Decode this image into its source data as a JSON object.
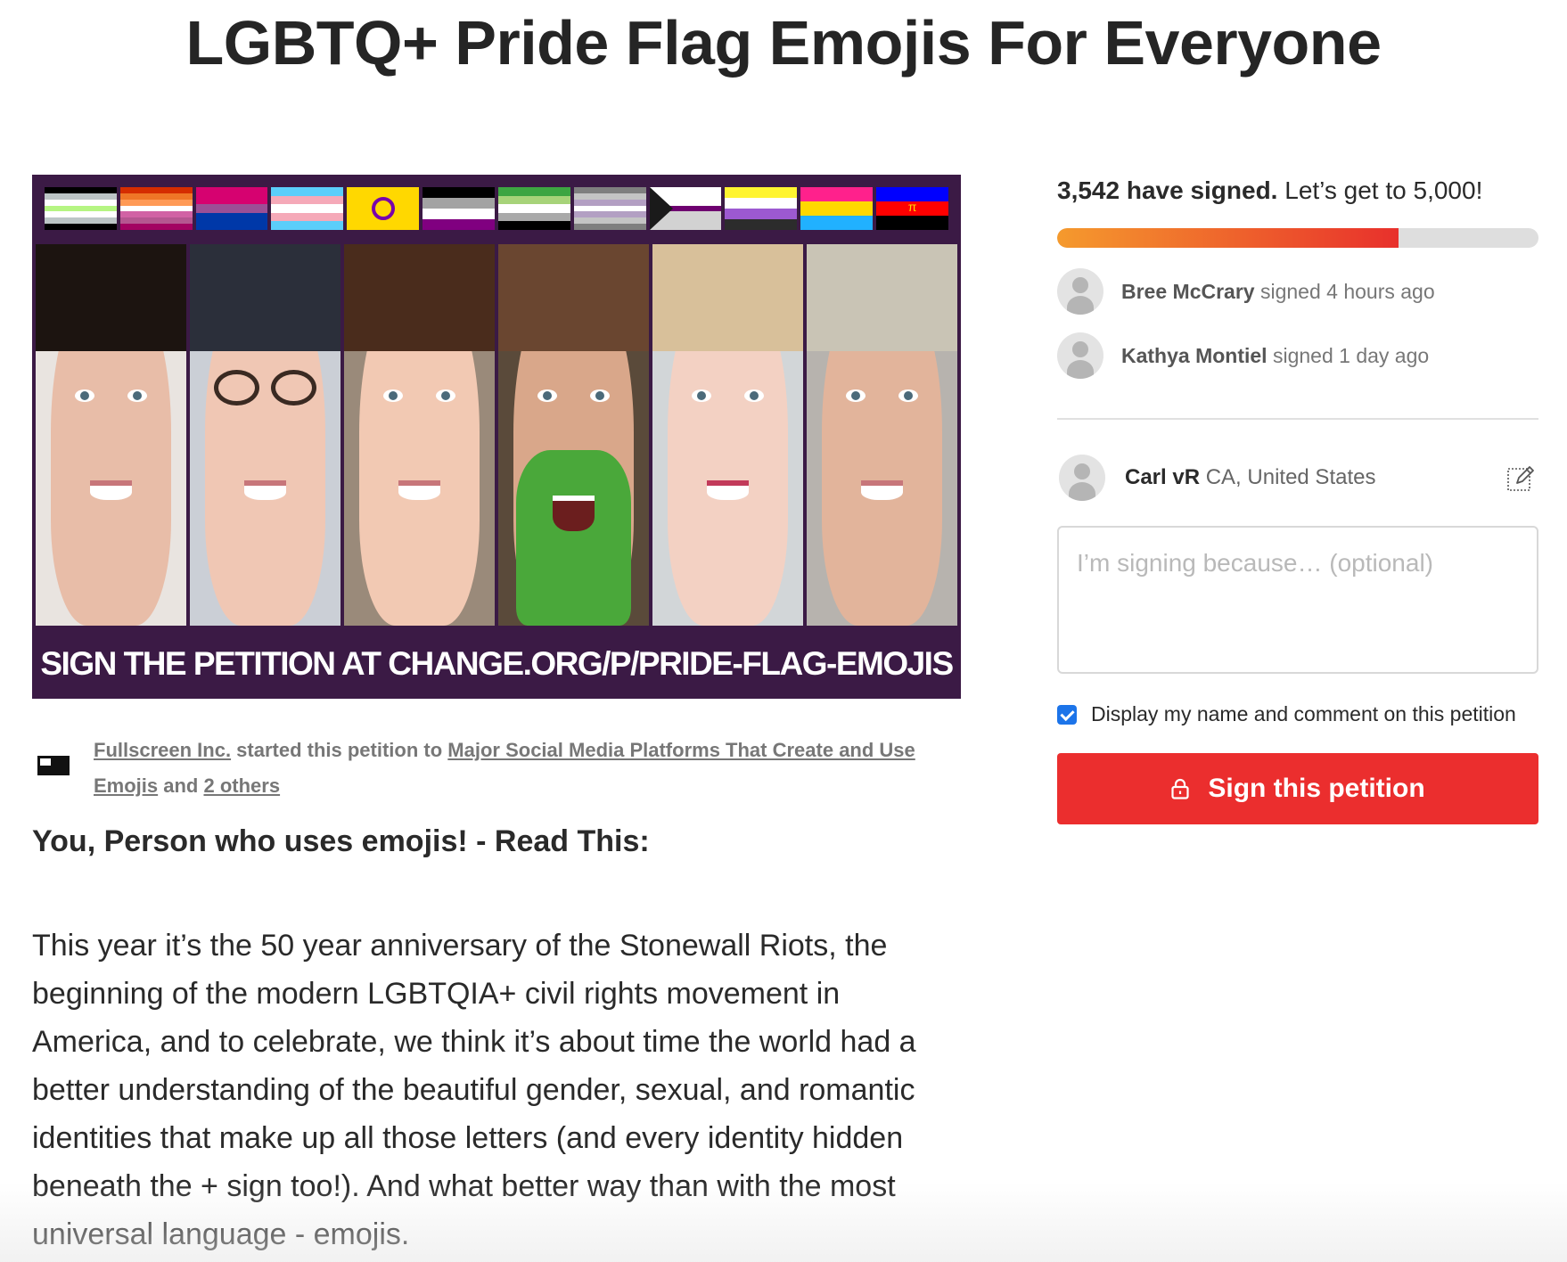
{
  "page": {
    "title": "LGBTQ+ Pride Flag Emojis For Everyone"
  },
  "banner": {
    "caption": "SIGN THE PETITION AT CHANGE.ORG/P/PRIDE-FLAG-EMOJIS",
    "flags": [
      "agender",
      "lesbian",
      "bisexual",
      "transgender",
      "intersex",
      "asexual",
      "aromantic",
      "demigender",
      "demisexual",
      "nonbinary",
      "pansexual",
      "polyamory"
    ]
  },
  "starter": {
    "org": "Fullscreen Inc.",
    "started_text": " started this petition to ",
    "target": "Major Social Media Platforms That Create and Use Emojis",
    "and_text": " and ",
    "others": "2 others"
  },
  "article": {
    "subhead": "You, Person who uses emojis! - Read This:",
    "body": "This year it’s the 50 year anniversary of the Stonewall Riots, the beginning of the modern LGBTQIA+ civil rights movement in America, and to celebrate, we think it’s about time the world had a better understanding of the beautiful gender, sexual, and romantic identities that make up all those letters (and every identity hidden beneath the + sign too!). And what better way than with the most universal language - emojis."
  },
  "signatures": {
    "count_text": "3,542 have signed.",
    "goal_text": " Let’s get to 5,000!",
    "count": 3542,
    "goal": 5000,
    "recent": [
      {
        "name": "Bree McCrary",
        "action": " signed 4 hours ago"
      },
      {
        "name": "Kathya Montiel",
        "action": " signed 1 day ago"
      }
    ]
  },
  "form": {
    "user_name": "Carl vR",
    "user_location": " CA, United States",
    "reason_placeholder": "I’m signing because… (optional)",
    "display_label": "Display my name and comment on this petition",
    "display_checked": true,
    "sign_button": "Sign this petition"
  },
  "colors": {
    "accent": "#eb2e2e",
    "checkbox": "#1c74e9",
    "progress_start": "#f59a2d",
    "progress_end": "#e8302c"
  },
  "icons": [
    "edit-icon",
    "lock-icon",
    "avatar-placeholder-icon",
    "fullscreen-logo-icon"
  ]
}
